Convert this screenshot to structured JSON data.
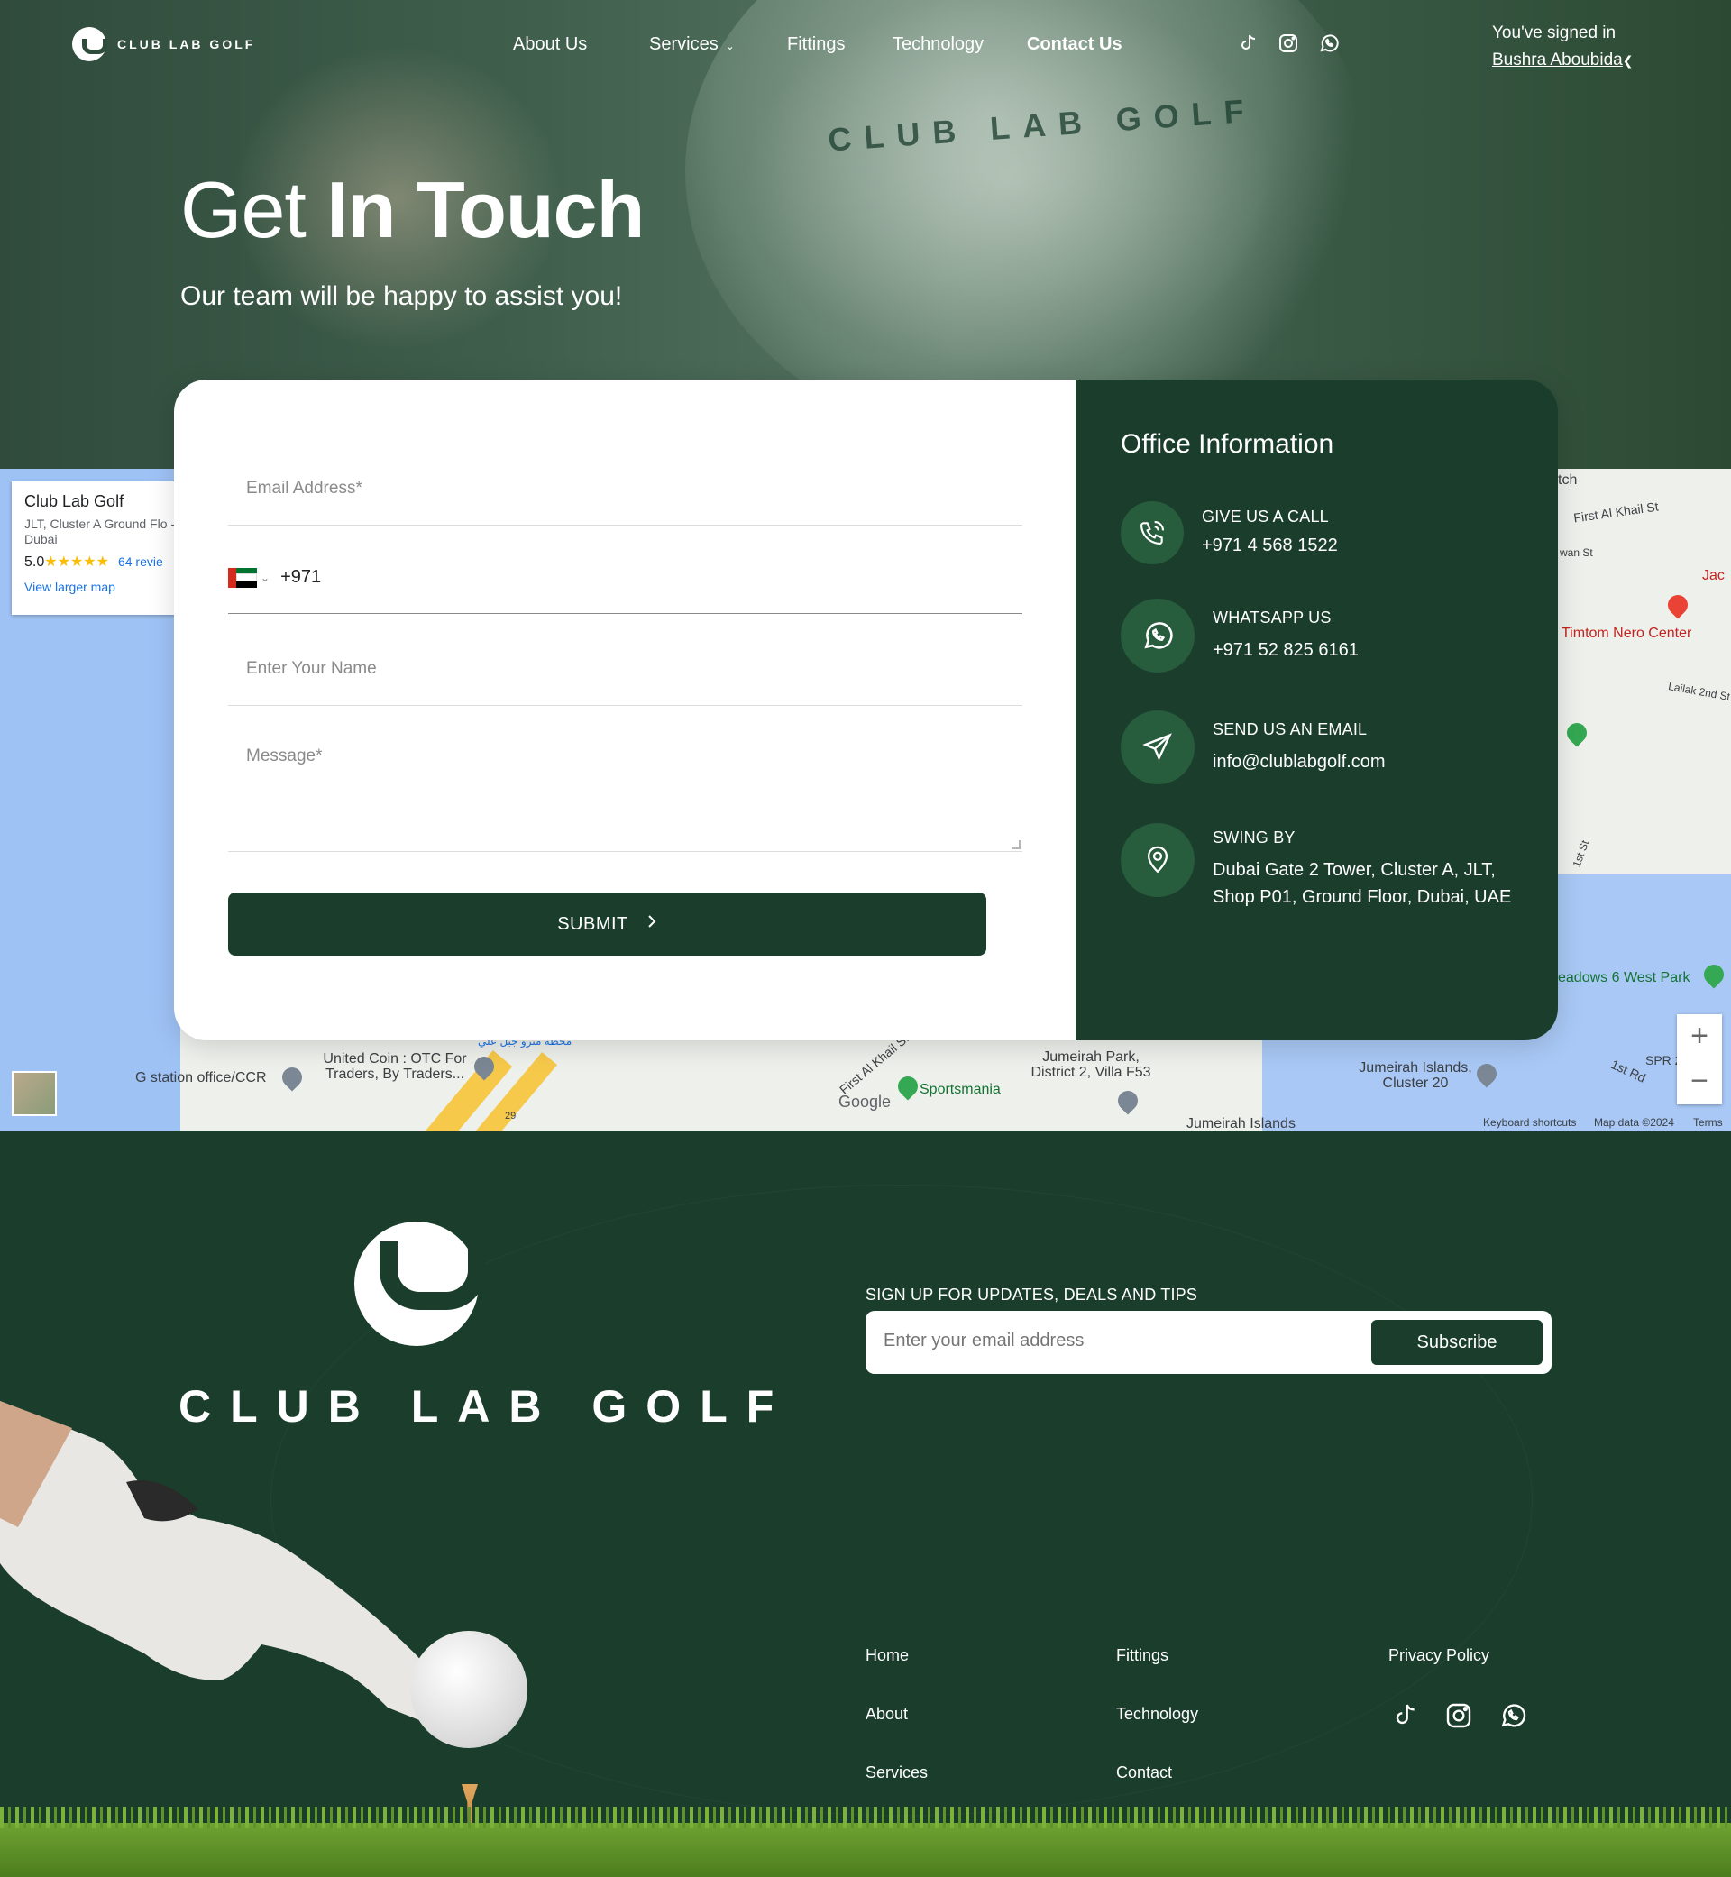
{
  "nav": {
    "logo_text": "CLUB LAB GOLF",
    "links": [
      {
        "label": "About Us"
      },
      {
        "label": "Services"
      },
      {
        "label": "Fittings"
      },
      {
        "label": "Technology"
      },
      {
        "label": "Contact Us"
      }
    ],
    "signed_in_label": "You've signed in",
    "user_name": "Bushra Aboubida",
    "social": [
      "tiktok-icon",
      "instagram-icon",
      "whatsapp-icon"
    ]
  },
  "hero": {
    "title_light": "Get",
    "title_bold": "In Touch",
    "subtitle": "Our team will be happy to assist you!",
    "ball_text": "CLUB LAB GOLF"
  },
  "form": {
    "email_placeholder": "Email Address*",
    "phone_code": "+971",
    "name_placeholder": "Enter Your Name",
    "message_placeholder": "Message*",
    "submit_label": "SUBMIT"
  },
  "office": {
    "title": "Office Information",
    "items": [
      {
        "label": "GIVE US A CALL",
        "value": "+971 4 568 1522",
        "icon": "phone-icon"
      },
      {
        "label": "WHATSAPP US",
        "value": "+971 52 825 6161",
        "icon": "whatsapp-icon"
      },
      {
        "label": "SEND US AN EMAIL",
        "value": "info@clublabgolf.com",
        "icon": "send-icon"
      },
      {
        "label": "SWING BY",
        "value": "Dubai Gate 2 Tower, Cluster A, JLT, Shop P01, Ground Floor, Dubai, UAE",
        "icon": "location-pin-icon"
      }
    ]
  },
  "map": {
    "card_title": "Club Lab Golf",
    "card_address": "JLT, Cluster A Ground Flo - Dubai",
    "rating": "5.0",
    "stars": "★★★★★",
    "reviews": "64 revie",
    "view_larger": "View larger map",
    "labels": {
      "first_al_khail": "First Al Khail St",
      "timtom": "Timtom Nero Center",
      "jac": "Jac",
      "meadows": "eadows 6 West Park",
      "jumeirah_park": "Jumeirah Park, District 2, Villa F53",
      "jumeirah_islands_c20": "Jumeirah Islands, Cluster 20",
      "jumeirah_islands": "Jumeirah Islands",
      "sportsmania": "Sportsmania",
      "united_coin": "United Coin : OTC For Traders, By Traders...",
      "station": "G station office/CCR",
      "google": "Google",
      "first_al_khail_st2": "First Al Khail St",
      "lailak": "Lailak 2nd St",
      "st1": "1st St",
      "st1_rd": "1st Rd",
      "tch": "tch",
      "wan_st": "wan St",
      "spr": "SPR 2",
      "arabic": "محطة مترو جبل علي",
      "road_num": "29"
    },
    "footer": {
      "shortcuts": "Keyboard shortcuts",
      "data": "Map data ©2024",
      "terms": "Terms"
    },
    "zoom_in": "+",
    "zoom_out": "−"
  },
  "footer": {
    "brand": "CLUB LAB GOLF",
    "signup_label": "SIGN UP FOR UPDATES, DEALS AND TIPS",
    "email_placeholder": "Enter your email address",
    "subscribe_label": "Subscribe",
    "links": {
      "home": "Home",
      "about": "About",
      "services": "Services",
      "fittings": "Fittings",
      "technology": "Technology",
      "contact": "Contact",
      "privacy": "Privacy Policy"
    },
    "social": [
      "tiktok-icon",
      "instagram-icon",
      "whatsapp-icon"
    ]
  },
  "colors": {
    "brand_green": "#1a3d2c",
    "icon_circle": "#275c3d"
  }
}
